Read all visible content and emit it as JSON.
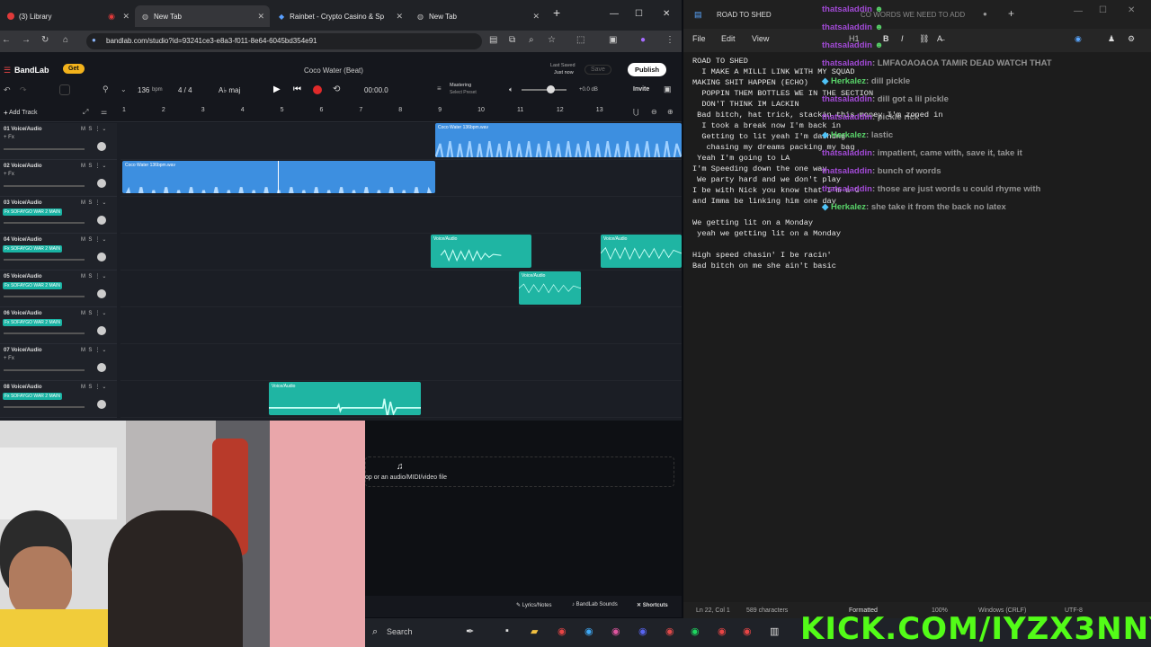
{
  "browser": {
    "tabs": [
      {
        "label": "(3) Library"
      },
      {
        "label": "New Tab"
      },
      {
        "label": "Rainbet - Crypto Casino & Sp"
      },
      {
        "label": "New Tab"
      }
    ],
    "url": "bandlab.com/studio?id=93241ce3-e8a3-f011-8e64-6045bd354e91"
  },
  "bandlab": {
    "logo": "BandLab",
    "get_label": "Get",
    "project_title": "Coco Water (Beat)",
    "last_saved": "Last Saved",
    "saved_when": "Just now",
    "save_label": "Save",
    "publish_label": "Publish",
    "tempo": "136",
    "tempo_unit": "bpm",
    "time_sig": "4 / 4",
    "key": "maj",
    "time": "00:00.0",
    "mastering": "Mastering",
    "select_preset": "Select Preset",
    "db": "+0.0 dB",
    "invite_label": "Invite",
    "add_track": "Add Track",
    "ruler": [
      "1",
      "2",
      "3",
      "4",
      "5",
      "6",
      "7",
      "8",
      "9",
      "10",
      "11",
      "12",
      "13"
    ],
    "tracks": [
      {
        "name": "01 Voice/Audio",
        "fx": "+ Fx"
      },
      {
        "name": "02 Voice/Audio",
        "fx": "+ Fx"
      },
      {
        "name": "03 Voice/Audio",
        "fx": "Fx SOFAYGO WAR 2 MAIN"
      },
      {
        "name": "04 Voice/Audio",
        "fx": "Fx SOFAYGO WAR 2 MAIN"
      },
      {
        "name": "05 Voice/Audio",
        "fx": "Fx SOFAYGO WAR 2 MAIN"
      },
      {
        "name": "06 Voice/Audio",
        "fx": "Fx SOFAYGO WAR 2 MAIN"
      },
      {
        "name": "07 Voice/Audio",
        "fx": "+ Fx"
      },
      {
        "name": "08 Voice/Audio",
        "fx": "Fx SOFAYGO WAR 2 MAIN"
      }
    ],
    "clips": {
      "c1": "Coco Water 136bpm.wav",
      "c2": "Coco Water 136bpm.wav",
      "c3": "Voice/Audio",
      "c4": "Voice/Audio",
      "c5": "Voice/Audio",
      "c6": "Voice/Audio"
    },
    "drop_text": "op or an audio/MIDI/video file",
    "footer": {
      "lyrics": "Lyrics/Notes",
      "sounds": "BandLab Sounds",
      "shortcuts": "Shortcuts"
    },
    "colors": {
      "blue": "#3d8fe0",
      "teal": "#1fb5a3",
      "record": "#e02a2a"
    }
  },
  "notepad": {
    "tab1": "ROAD TO SHED",
    "tab2": "CO WORDS WE NEED TO ADD",
    "menu": {
      "file": "File",
      "edit": "Edit",
      "view": "View"
    },
    "heading_btn": "H1",
    "text": "ROAD TO SHED\n  I MAKE A MILLI LINK WITH MY SQUAD\nMAKING SHIT HAPPEN (ECHO)\n  POPPIN THEM BOTTLES WE IN THE SECTION\n  DON'T THINK IM LACKIN\n Bad bitch, hat trick, stackin this money I'm zoned in\n  I took a break now I'm back in\n  Getting to lit yeah I'm dashing\n   chasing my dreams packing my bag\n Yeah I'm going to LA\nI'm Speeding down the one way\n We party hard and we don't play\nI be with Nick you know that I'm a G\nand Imma be linking him one day\n\nWe getting lit on a Monday\n yeah we getting lit on a Monday\n\nHigh speed chasin' I be racin'\nBad bitch on me she ain't basic",
    "status": {
      "pos": "Ln 22, Col 1",
      "chars": "589 characters",
      "format": "Formatted",
      "zoom": "100%",
      "eol": "Windows (CRLF)",
      "enc": "UTF-8"
    }
  },
  "chat": [
    {
      "user": "thatsaladdin",
      "text": ""
    },
    {
      "user": "thatsaladdin",
      "text": ""
    },
    {
      "user": "thatsaladdin",
      "text": ""
    },
    {
      "user": "thatsaladdin",
      "text": ": LMFAOAOAOA TAMIR DEAD WATCH THAT"
    },
    {
      "user": "Herkalez",
      "text": ": dill pickle"
    },
    {
      "user": "thatsaladdin",
      "text": ": dill got a lil pickle"
    },
    {
      "user": "thatsaladdin",
      "text": ": pickle rick"
    },
    {
      "user": "Herkalez",
      "text": ": lastic"
    },
    {
      "user": "thatsaladdin",
      "text": ": impatient, came with, save it, take it"
    },
    {
      "user": "thatsaladdin",
      "text": ": bunch of words"
    },
    {
      "user": "thatsaladdin",
      "text": ": those are just words u could rhyme with"
    },
    {
      "user": "Herkalez",
      "text": ": she take it from the back no latex"
    }
  ],
  "taskbar": {
    "search": "Search"
  },
  "kick_watermark": "KICK.COM/IYZX3NNY"
}
